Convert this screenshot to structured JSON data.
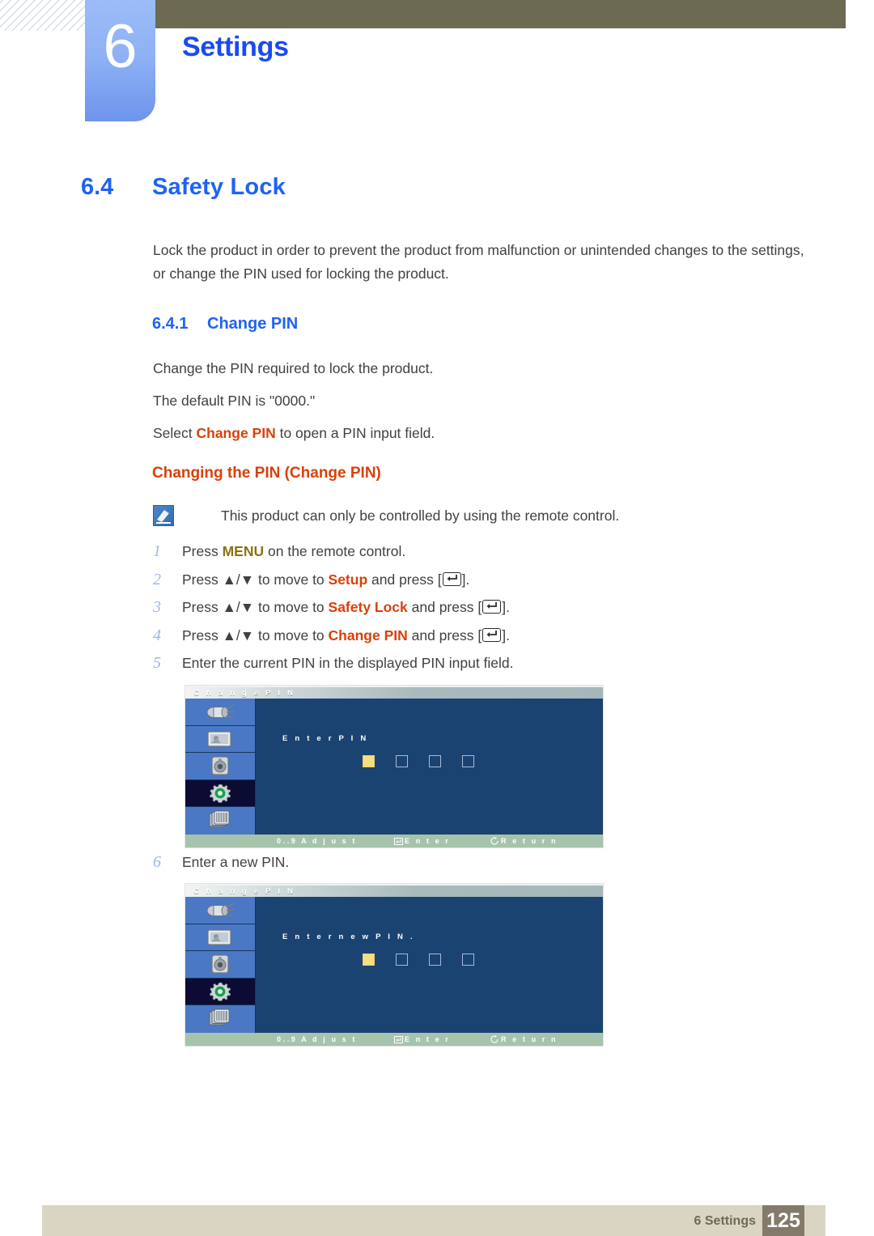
{
  "header": {
    "chapter_number": "6",
    "chapter_title": "Settings"
  },
  "section": {
    "number": "6.4",
    "title": "Safety Lock",
    "intro": "Lock the product in order to prevent the product from malfunction or unintended changes to the settings, or change the PIN used for locking the product."
  },
  "subsection": {
    "number": "6.4.1",
    "title": "Change PIN",
    "paragraph_1": "Change the PIN required to lock the product.",
    "paragraph_2": "The default PIN is \"0000.\"",
    "paragraph_3_pre": "Select ",
    "paragraph_3_keyword": "Change PIN",
    "paragraph_3_post": " to open a PIN input field."
  },
  "procedure": {
    "heading": "Changing the PIN (Change PIN)",
    "note_icon": "note-pencil-icon",
    "note": "This product can only be controlled by using the remote control.",
    "steps": [
      {
        "number": "1",
        "pre": "Press ",
        "keyword": "MENU",
        "keyword_color": "gold",
        "post": " on the remote control.",
        "has_enter_key": false
      },
      {
        "number": "2",
        "pre": "Press ▲/▼ to move to ",
        "keyword": "Setup",
        "keyword_color": "orange",
        "post": " and press [",
        "tail": "].",
        "has_enter_key": true
      },
      {
        "number": "3",
        "pre": "Press ▲/▼ to move to ",
        "keyword": "Safety Lock",
        "keyword_color": "orange",
        "post": " and press [",
        "tail": "].",
        "has_enter_key": true
      },
      {
        "number": "4",
        "pre": "Press ▲/▼ to move to ",
        "keyword": "Change PIN",
        "keyword_color": "orange",
        "post": " and press [",
        "tail": "].",
        "has_enter_key": true
      },
      {
        "number": "5",
        "pre": "Enter the current PIN in the displayed PIN input field.",
        "keyword": "",
        "post": "",
        "has_enter_key": false
      },
      {
        "number": "6",
        "pre": "Enter a new PIN.",
        "keyword": "",
        "post": "",
        "has_enter_key": false
      }
    ]
  },
  "osd_screens": [
    {
      "title": "C h a n g e  P I N",
      "prompt": "E n t e r  P I N",
      "sidebar_icons": [
        "input-plug-icon",
        "picture-icon",
        "sound-speaker-icon",
        "setup-gear-icon",
        "multi-control-icon"
      ],
      "active_icon_index": 3,
      "pin_boxes": [
        "filled",
        "empty",
        "empty",
        "empty"
      ],
      "footer": {
        "adjust": "0..9 A d j u s t",
        "enter": "E n t e r",
        "return": "R e t u r n",
        "enter_icon": "enter-key-icon",
        "return_icon": "return-arrow-icon"
      }
    },
    {
      "title": "C h a n g e  P I N",
      "prompt": "E n t e r  n e w  P I N .",
      "sidebar_icons": [
        "input-plug-icon",
        "picture-icon",
        "sound-speaker-icon",
        "setup-gear-icon",
        "multi-control-icon"
      ],
      "active_icon_index": 3,
      "pin_boxes": [
        "filled",
        "empty",
        "empty",
        "empty"
      ],
      "footer": {
        "adjust": "0..9 A d j u s t",
        "enter": "E n t e r",
        "return": "R e t u r n",
        "enter_icon": "enter-key-icon",
        "return_icon": "return-arrow-icon"
      }
    }
  ],
  "footer": {
    "chapter_label": "6 Settings",
    "page_number": "125"
  },
  "colors": {
    "heading_blue": "#1e63f2",
    "keyword_orange": "#d8410c",
    "keyword_gold": "#8a7214",
    "tab_blue": "#8fb2f5",
    "olive": "#6d6a53",
    "footer_beige": "#d9d5c2",
    "page_box": "#847a6c",
    "osd_blue": "#1b4372",
    "osd_sidebar_blue": "#4a78c4",
    "osd_footer_green": "#a5c4ab",
    "pin_fill_yellow": "#f5dd80"
  }
}
